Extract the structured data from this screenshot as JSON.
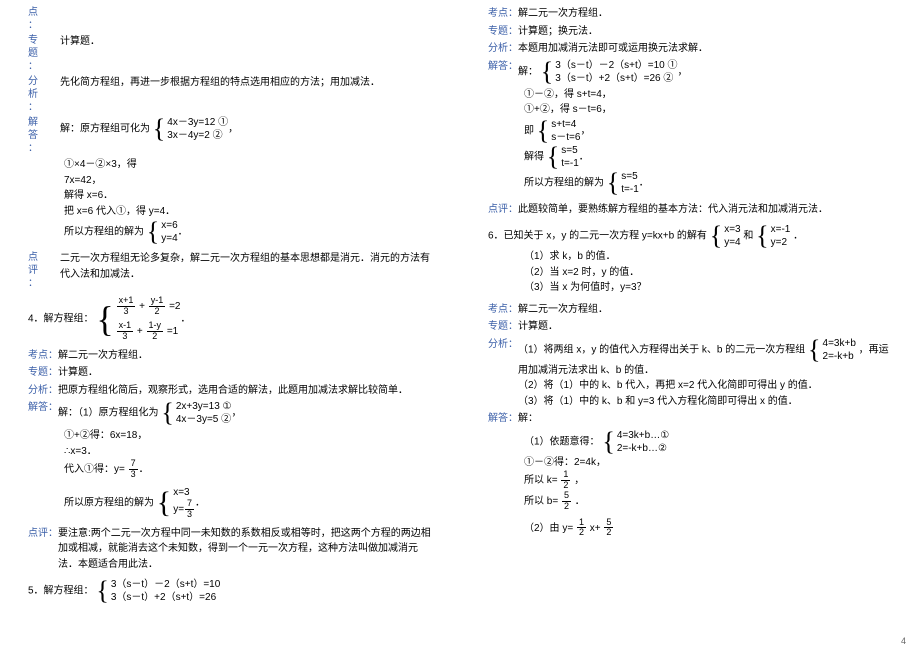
{
  "pageNumber": "4",
  "left": {
    "label_dian": "点",
    "label_dian2": "：",
    "label_zhuan": "专",
    "label_ti": "题",
    "label_ti2": "：",
    "label_fen": "分",
    "label_xi": "析",
    "label_xi2": "：",
    "label_jie": "解",
    "label_da": "答",
    "label_da2": "：",
    "label_dianp": "点",
    "label_ping": "评",
    "label_ping2": "：",
    "zhuanti1": "计算题．",
    "fenxi1": "先化简方程组，再进一步根据方程组的特点选用相应的方法；用加减法．",
    "solve_prefix": "解：原方程组可化为",
    "eq1a": "4x－3y=12  ①",
    "eq1b": "3x－4y=2   ②",
    "step1": "①×4－②×3，得",
    "step2": "7x=42，",
    "step3": "解得 x=6．",
    "step4": "把 x=6 代入①，得 y=4．",
    "step5_prefix": "所以方程组的解为",
    "sol1a": "x=6",
    "sol1b": "y=4",
    "dianping1": "二元一次方程组无论多复杂，解二元一次方程组的基本思想都是消元．消元的方法有代入法和加减法．",
    "q4_prefix": "4．解方程组：",
    "q4a_l": "+",
    "q4a_r": "=2",
    "q4b_l": "+",
    "q4b_r": "=1",
    "fx1n": "x+1",
    "fx1d": "3",
    "fy1n": "y-1",
    "fy1d": "2",
    "fx2n": "x-1",
    "fx2d": "3",
    "fy2n": "1-y",
    "fy2d": "2",
    "label_kaodian": "考点：",
    "label_zhuanti": "专题：",
    "label_fenxi": "分析：",
    "label_jieda": "解答：",
    "label_dianping": "点评：",
    "kaodian4": "解二元一次方程组．",
    "zhuanti4": "计算题．",
    "fenxi4": "把原方程组化简后，观察形式，选用合适的解法，此题用加减法求解比较简单．",
    "jieda4_prefix": "解：（1）原方程组化为",
    "eq4a": "2x+3y=13  ①",
    "eq4b": "4x－3y=5   ②",
    "step41": "①+②得：6x=18，",
    "step42": "∴x=3．",
    "step43_prefix": "代入①得：y=",
    "seven": "7",
    "three": "3",
    "step44_prefix": "所以原方程组的解为",
    "sol4a": "x=3",
    "sol4b_prefix": "y=",
    "dianping4": "要注意:两个二元一次方程中同一未知数的系数相反或相等时，把这两个方程的两边相加或相减，就能消去这个未知数，得到一个一元一次方程，这种方法叫做加减消元法．本题适合用此法．",
    "q5_prefix": "5．解方程组：",
    "eq5a": "3（s－t）－2（s+t）=10",
    "eq5b": "3（s－t）+2（s+t）=26"
  },
  "right": {
    "label_kaodian": "考点：",
    "label_zhuanti": "专题：",
    "label_fenxi": "分析：",
    "label_jieda": "解答：",
    "label_dianping": "点评：",
    "kaodian5": "解二元一次方程组．",
    "zhuanti5": "计算题；换元法．",
    "fenxi5": "本题用加减消元法即可或运用换元法求解．",
    "jieda5_prefix": "解：",
    "eq5a": "3（s－t）－2（s+t）=10   ①",
    "eq5b": "3（s－t）+2（s+t）=26   ②",
    "step51": "①－②，得 s+t=4，",
    "step52": "①+②，得 s－t=6，",
    "step53_prefix": "即",
    "pair1a": "s+t=4",
    "pair1b": "s－t=6",
    "step54_prefix": "解得",
    "pair2a": "s=5",
    "pair2b": "t=-1",
    "step55_prefix": "所以方程组的解为",
    "pair3a": "s=5",
    "pair3b": "t=-1",
    "dianping5": "此题较简单，要熟练解方程组的基本方法：代入消元法和加减消元法．",
    "q6_prefix": "6．已知关于 x，y 的二元一次方程 y=kx+b 的解有",
    "q6_and": "和",
    "q6_end": "．",
    "pair4a": "x=3",
    "pair4b": "y=4",
    "pair5a": "x=-1",
    "pair5b": "y=2",
    "q6_1": "（1）求 k，b 的值．",
    "q6_2": "（2）当 x=2 时，y 的值．",
    "q6_3": "（3）当 x 为何值时，y=3？",
    "kaodian6": "解二元一次方程组．",
    "zhuanti6": "计算题．",
    "fenxi6a": "（1）将两组 x，y 的值代入方程得出关于 k、b 的二元一次方程组",
    "fenxi6b": "，再运用加减消元法求出 k、b 的值．",
    "pair6a": "4=3k+b",
    "pair6b": "2=-k+b",
    "fenxi6c": "（2）将（1）中的 k、b 代入，再把 x=2 代入化简即可得出 y 的值．",
    "fenxi6d": "（3）将（1）中的 k、b 和 y=3 代入方程化简即可得出 x 的值．",
    "jieda6_prefix": "解：",
    "jieda6_1": "（1）依题意得：",
    "pair7a": "4=3k+b…①",
    "pair7b": "2=-k+b…②",
    "step61": "①－②得：2=4k，",
    "step62_prefix": "所以 k=",
    "one": "1",
    "two": "2",
    "five": "5",
    "step63_prefix": "所以 b=",
    "step64_prefix": "（2）由 y=",
    "step64_mid": "x+",
    "comma": "，",
    "period": "．"
  }
}
